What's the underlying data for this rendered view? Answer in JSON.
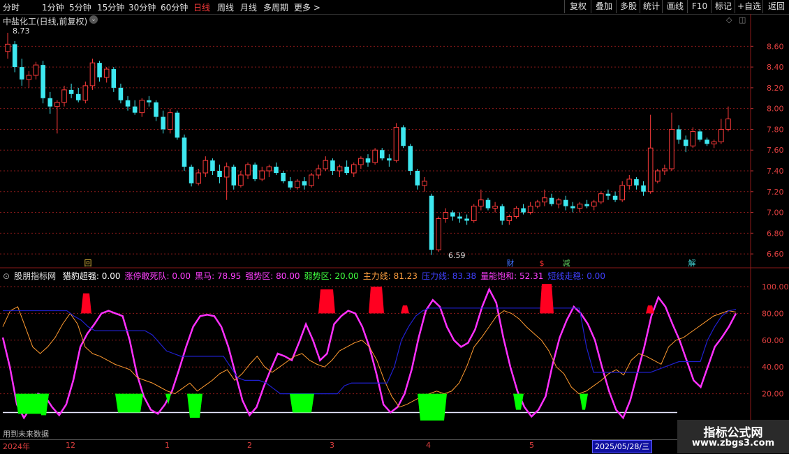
{
  "toolbar": {
    "periods": [
      "分时",
      "1分钟",
      "5分钟",
      "15分钟",
      "30分钟",
      "60分钟",
      "日线",
      "周线",
      "月线",
      "多周期",
      "更多 >"
    ],
    "active": "日线",
    "right_buttons": [
      "复权",
      "叠加",
      "多股",
      "统计",
      "画线",
      "F10",
      "标记",
      "+自选",
      "返回"
    ]
  },
  "main_chart": {
    "title": "中盐化工(日线,前复权)",
    "high_label": "8.73",
    "low_label": "6.59",
    "y_ticks": [
      "8.60",
      "8.40",
      "8.20",
      "8.00",
      "7.80",
      "7.60",
      "7.40",
      "7.20",
      "7.00",
      "6.80",
      "6.60"
    ],
    "event_markers": [
      "回",
      "财",
      "$",
      "减",
      "解"
    ]
  },
  "indicator": {
    "name": "股朋指标网",
    "items": [
      {
        "label": "猎豹超强: 0.00",
        "color": "#ffffff"
      },
      {
        "label": "涨停敢死队: 0.00",
        "color": "#ff40ff"
      },
      {
        "label": "黑马: 78.95",
        "color": "#ff40ff"
      },
      {
        "label": "强势区: 80.00",
        "color": "#ff40ff"
      },
      {
        "label": "弱势区: 20.00",
        "color": "#40ff40"
      },
      {
        "label": "主力线: 81.23",
        "color": "#ffa040"
      },
      {
        "label": "压力线: 83.38",
        "color": "#4040ff"
      },
      {
        "label": "量能饱和: 52.31",
        "color": "#ff40ff"
      },
      {
        "label": "短线走稳: 0.00",
        "color": "#4040ff"
      }
    ],
    "y_ticks": [
      "100.00",
      "80.00",
      "60.00",
      "40.00",
      "20.00"
    ]
  },
  "bottom": {
    "note": "用到未来数据",
    "x_ticks": [
      "2024年",
      "12",
      "1",
      "2",
      "3",
      "4",
      "5"
    ],
    "date_box": "2025/05/28/三"
  },
  "watermark": {
    "line1": "指标公式网",
    "line2": "www.zbgs3.com"
  },
  "colors": {
    "up": "#ff3b3b",
    "down": "#3ee8f0",
    "grid": "#8b1a1a",
    "pink": "#ff30ff",
    "blue": "#2020d0",
    "orange": "#ff9a30",
    "green": "#00ff00",
    "red": "#ff0020"
  },
  "chart_data": {
    "type": "candlestick",
    "title": "中盐化工(日线,前复权)",
    "ylim": [
      6.5,
      8.75
    ],
    "candles": [
      [
        8.55,
        8.73,
        8.48,
        8.62
      ],
      [
        8.62,
        8.65,
        8.35,
        8.4
      ],
      [
        8.4,
        8.48,
        8.22,
        8.28
      ],
      [
        8.28,
        8.36,
        8.2,
        8.32
      ],
      [
        8.32,
        8.45,
        8.28,
        8.42
      ],
      [
        8.42,
        8.46,
        8.05,
        8.1
      ],
      [
        8.1,
        8.16,
        7.95,
        8.02
      ],
      [
        8.02,
        8.08,
        7.76,
        8.06
      ],
      [
        8.06,
        8.22,
        8.02,
        8.18
      ],
      [
        8.18,
        8.24,
        8.1,
        8.14
      ],
      [
        8.14,
        8.2,
        8.06,
        8.08
      ],
      [
        8.08,
        8.26,
        8.05,
        8.22
      ],
      [
        8.22,
        8.48,
        8.18,
        8.44
      ],
      [
        8.44,
        8.46,
        8.26,
        8.3
      ],
      [
        8.3,
        8.4,
        8.25,
        8.38
      ],
      [
        8.38,
        8.4,
        8.16,
        8.2
      ],
      [
        8.2,
        8.24,
        8.05,
        8.08
      ],
      [
        8.08,
        8.12,
        7.98,
        8.02
      ],
      [
        8.02,
        8.08,
        7.94,
        7.96
      ],
      [
        7.96,
        8.1,
        7.92,
        8.08
      ],
      [
        8.08,
        8.12,
        8.02,
        8.06
      ],
      [
        8.06,
        8.08,
        7.88,
        7.92
      ],
      [
        7.92,
        7.98,
        7.76,
        7.8
      ],
      [
        7.8,
        8.0,
        7.76,
        7.96
      ],
      [
        7.96,
        7.98,
        7.7,
        7.72
      ],
      [
        7.72,
        7.75,
        7.4,
        7.44
      ],
      [
        7.44,
        7.46,
        7.25,
        7.28
      ],
      [
        7.28,
        7.42,
        7.26,
        7.38
      ],
      [
        7.38,
        7.54,
        7.34,
        7.5
      ],
      [
        7.5,
        7.52,
        7.36,
        7.4
      ],
      [
        7.4,
        7.46,
        7.28,
        7.34
      ],
      [
        7.34,
        7.48,
        7.12,
        7.44
      ],
      [
        7.44,
        7.46,
        7.22,
        7.26
      ],
      [
        7.26,
        7.4,
        7.24,
        7.36
      ],
      [
        7.36,
        7.48,
        7.32,
        7.46
      ],
      [
        7.46,
        7.48,
        7.3,
        7.32
      ],
      [
        7.32,
        7.44,
        7.3,
        7.4
      ],
      [
        7.4,
        7.46,
        7.34,
        7.44
      ],
      [
        7.44,
        7.48,
        7.36,
        7.38
      ],
      [
        7.38,
        7.4,
        7.28,
        7.3
      ],
      [
        7.3,
        7.34,
        7.22,
        7.24
      ],
      [
        7.24,
        7.32,
        7.22,
        7.3
      ],
      [
        7.3,
        7.34,
        7.22,
        7.26
      ],
      [
        7.26,
        7.38,
        7.24,
        7.36
      ],
      [
        7.36,
        7.46,
        7.32,
        7.42
      ],
      [
        7.42,
        7.54,
        7.4,
        7.5
      ],
      [
        7.5,
        7.52,
        7.36,
        7.4
      ],
      [
        7.4,
        7.46,
        7.34,
        7.44
      ],
      [
        7.44,
        7.5,
        7.36,
        7.38
      ],
      [
        7.38,
        7.48,
        7.34,
        7.46
      ],
      [
        7.46,
        7.54,
        7.42,
        7.52
      ],
      [
        7.52,
        7.56,
        7.44,
        7.48
      ],
      [
        7.48,
        7.62,
        7.46,
        7.6
      ],
      [
        7.6,
        7.62,
        7.5,
        7.52
      ],
      [
        7.52,
        7.56,
        7.44,
        7.5
      ],
      [
        7.5,
        7.86,
        7.48,
        7.82
      ],
      [
        7.82,
        7.84,
        7.62,
        7.64
      ],
      [
        7.64,
        7.66,
        7.36,
        7.4
      ],
      [
        7.4,
        7.42,
        7.22,
        7.26
      ],
      [
        7.26,
        7.34,
        7.2,
        7.3
      ],
      [
        7.16,
        7.18,
        6.59,
        6.64
      ],
      [
        6.64,
        6.96,
        6.62,
        6.94
      ],
      [
        6.94,
        7.04,
        6.9,
        7.0
      ],
      [
        7.0,
        7.02,
        6.92,
        6.96
      ],
      [
        6.96,
        7.0,
        6.9,
        6.94
      ],
      [
        6.94,
        6.98,
        6.88,
        6.92
      ],
      [
        6.92,
        7.08,
        6.9,
        7.06
      ],
      [
        7.06,
        7.22,
        7.02,
        7.12
      ],
      [
        7.12,
        7.14,
        7.02,
        7.04
      ],
      [
        7.04,
        7.1,
        7.0,
        7.06
      ],
      [
        7.06,
        7.08,
        6.88,
        6.92
      ],
      [
        6.92,
        6.98,
        6.88,
        6.96
      ],
      [
        6.96,
        7.06,
        6.94,
        7.04
      ],
      [
        7.04,
        7.08,
        6.98,
        7.0
      ],
      [
        7.0,
        7.1,
        6.98,
        7.06
      ],
      [
        7.06,
        7.12,
        7.04,
        7.1
      ],
      [
        7.1,
        7.22,
        7.06,
        7.14
      ],
      [
        7.14,
        7.18,
        7.06,
        7.08
      ],
      [
        7.08,
        7.14,
        7.04,
        7.12
      ],
      [
        7.12,
        7.16,
        7.02,
        7.06
      ],
      [
        7.06,
        7.1,
        7.0,
        7.04
      ],
      [
        7.04,
        7.1,
        7.0,
        7.08
      ],
      [
        7.08,
        7.12,
        7.04,
        7.06
      ],
      [
        7.06,
        7.12,
        7.02,
        7.1
      ],
      [
        7.1,
        7.2,
        7.08,
        7.18
      ],
      [
        7.18,
        7.22,
        7.12,
        7.16
      ],
      [
        7.16,
        7.2,
        7.1,
        7.12
      ],
      [
        7.12,
        7.3,
        7.1,
        7.26
      ],
      [
        7.26,
        7.36,
        7.22,
        7.32
      ],
      [
        7.32,
        7.34,
        7.22,
        7.26
      ],
      [
        7.26,
        7.3,
        7.16,
        7.2
      ],
      [
        7.2,
        7.94,
        7.18,
        7.62
      ],
      [
        7.3,
        7.42,
        7.28,
        7.4
      ],
      [
        7.4,
        7.46,
        7.36,
        7.42
      ],
      [
        7.42,
        7.96,
        7.4,
        7.8
      ],
      [
        7.8,
        7.84,
        7.66,
        7.7
      ],
      [
        7.7,
        7.74,
        7.58,
        7.64
      ],
      [
        7.64,
        7.82,
        7.62,
        7.78
      ],
      [
        7.78,
        7.8,
        7.68,
        7.7
      ],
      [
        7.7,
        7.72,
        7.64,
        7.66
      ],
      [
        7.66,
        7.7,
        7.62,
        7.68
      ],
      [
        7.68,
        7.9,
        7.66,
        7.8
      ],
      [
        7.8,
        8.02,
        7.78,
        7.9
      ]
    ]
  }
}
